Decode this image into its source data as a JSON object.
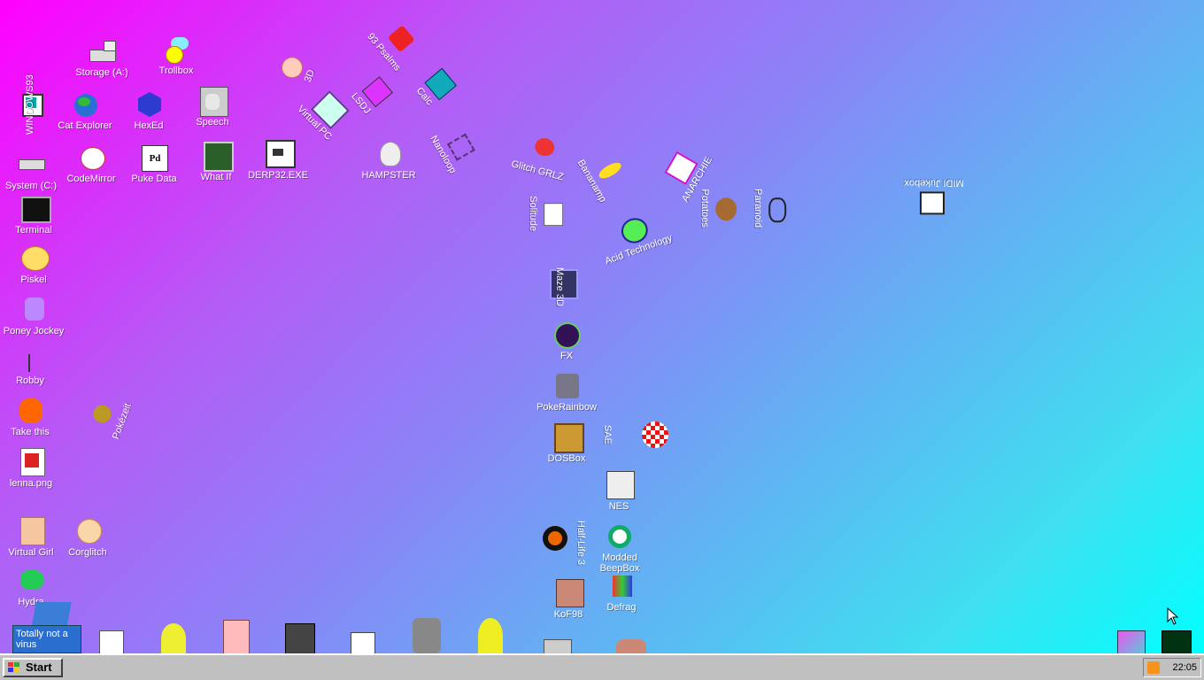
{
  "desktop": {
    "icons": {
      "storage_a": "Storage (A:)",
      "trollbox": "Trollbox",
      "windows93": "WINDOWS93",
      "cat_explorer": "Cat Explorer",
      "hexed": "HexEd",
      "speech": "Speech",
      "system_c": "System (C:)",
      "codemirror": "CodeMirror",
      "puke_data": "Puke Data",
      "what_if": "What If",
      "derp32": "DERP32.EXE",
      "three_d": "3D",
      "virtual_pc": "Virtual PC",
      "psalms": "93 Psalms",
      "lsdj": "LSDJ",
      "calc": "Calc",
      "hampster": "HAMPSTER",
      "nanoloop": "Nanoloop",
      "glitch_grlz": "Glitch GRLZ",
      "bananamp": "Bananamp",
      "anarchie": "ANARCHIE",
      "terminal": "Terminal",
      "piskel": "Piskel",
      "poney_jockey": "Poney Jockey",
      "robby": "Robby",
      "take_this": "Take this",
      "pokezeit": "Pokézeit",
      "lenna": "lenna.png",
      "virtual_girl": "Virtual Girl",
      "corglitch": "Corglitch",
      "hydra": "Hydra",
      "totally_not_a_virus": "Totally not a virus",
      "solitude": "Solitude",
      "acid_technology": "Acid Technology",
      "potatoes": "Potatoes",
      "paranoid": "Paranoid",
      "midi_jukebox": "MIDI Jukebox",
      "maze3d": "Maze 3D",
      "fx": "FX",
      "pokerainbow": "PokeRainbow",
      "dosbox": "DOSBox",
      "sae": "SAE",
      "nes": "NES",
      "halflife3": "Half-Life 3",
      "modded_beepbox": "Modded BeepBox",
      "kof98": "KoF98",
      "defrag": "Defrag"
    }
  },
  "taskbar": {
    "start_label": "Start",
    "clock": "22:05"
  }
}
